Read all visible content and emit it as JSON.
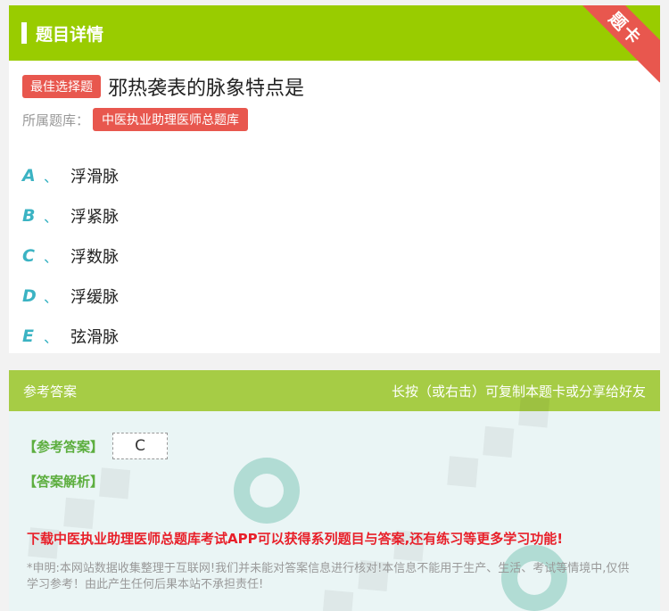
{
  "header": {
    "title": "题目详情",
    "ribbon": "题卡"
  },
  "question": {
    "tag": "最佳选择题",
    "text": "邪热袭表的脉象特点是"
  },
  "bank": {
    "label": "所属题库：",
    "name": "中医执业助理医师总题库"
  },
  "options": [
    {
      "letter": "A",
      "sep": "、",
      "text": "浮滑脉"
    },
    {
      "letter": "B",
      "sep": "、",
      "text": "浮紧脉"
    },
    {
      "letter": "C",
      "sep": "、",
      "text": "浮数脉"
    },
    {
      "letter": "D",
      "sep": "、",
      "text": "浮缓脉"
    },
    {
      "letter": "E",
      "sep": "、",
      "text": "弦滑脉"
    }
  ],
  "answer": {
    "title": "参考答案",
    "hint": "长按（或右击）可复制本题卡或分享给好友",
    "answer_label": "【参考答案】",
    "answer_value": "C",
    "analysis_label": "【答案解析】",
    "download_text": "下载中医执业助理医师总题库考试APP可以获得系列题目与答案,还有练习等更多学习功能!",
    "disclaimer": "*申明:本网站数据收集整理于互联网!我们并未能对答案信息进行核对!本信息不能用于生产、生活、考试等情境中,仅供学习参考！由此产生任何后果本站不承担责任!"
  },
  "colors": {
    "header_green": "#99cc00",
    "tag_red": "#e8574e",
    "option_teal": "#3bb3c3",
    "answer_green": "#5cae3e",
    "download_red": "#e8202a"
  }
}
